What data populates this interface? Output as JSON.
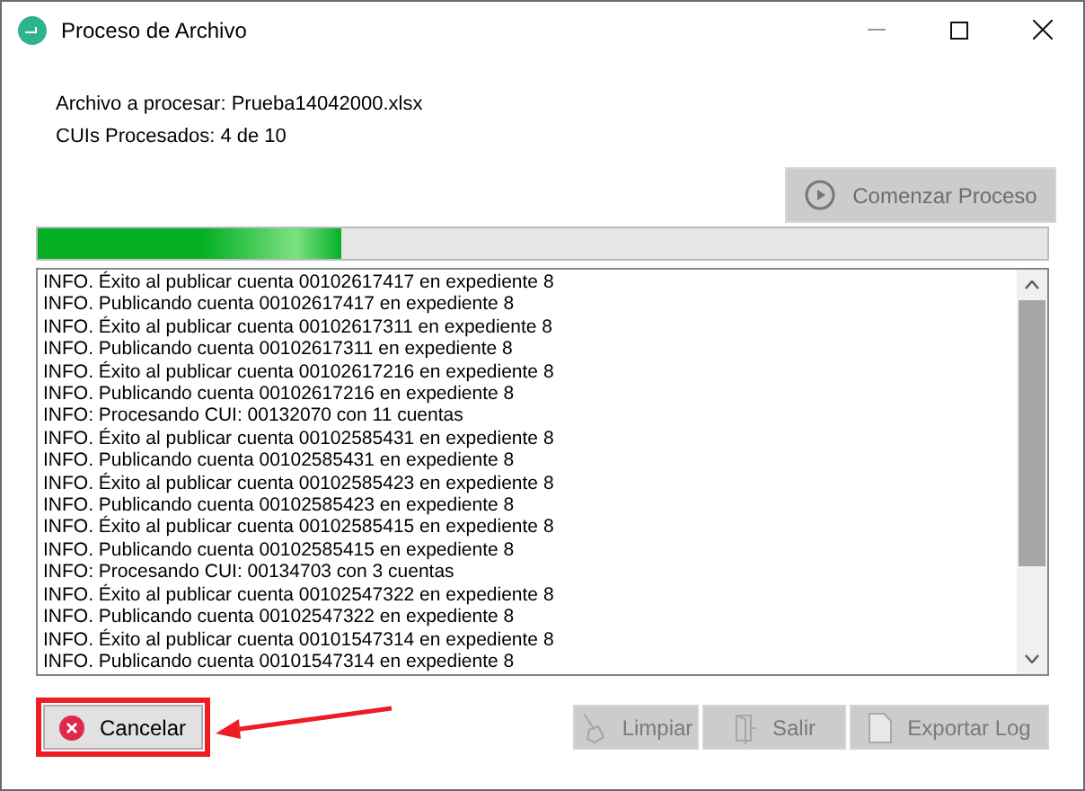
{
  "window": {
    "title": "Proceso de Archivo"
  },
  "info": [
    "Archivo a procesar: Prueba14042000.xlsx",
    "CUIs Procesados: 4 de 10"
  ],
  "start_button": {
    "label": "Comenzar Proceso",
    "disabled": true
  },
  "progress": {
    "level": 0.3
  },
  "log": [
    "INFO. Éxito al publicar cuenta 00102617417 en expediente 8",
    "INFO. Publicando cuenta 00102617417 en expediente 8",
    "INFO. Éxito al publicar cuenta 00102617311 en expediente 8",
    "INFO. Publicando cuenta 00102617311 en expediente 8",
    "INFO. Éxito al publicar cuenta 00102617216 en expediente 8",
    "INFO. Publicando cuenta 00102617216 en expediente 8",
    "INFO: Procesando CUI: 00132070 con 11 cuentas",
    "INFO. Éxito al publicar cuenta 00102585431 en expediente 8",
    "INFO. Publicando cuenta 00102585431 en expediente 8",
    "INFO. Éxito al publicar cuenta 00102585423 en expediente 8",
    "INFO. Publicando cuenta 00102585423 en expediente 8",
    "INFO. Éxito al publicar cuenta 00102585415 en expediente 8",
    "INFO. Publicando cuenta 00102585415 en expediente 8",
    "INFO: Procesando CUI: 00134703 con 3 cuentas",
    "INFO. Éxito al publicar cuenta 00102547322 en expediente 8",
    "INFO. Publicando cuenta 00102547322 en expediente 8",
    "INFO. Éxito al publicar cuenta 00101547314 en expediente 8",
    "INFO. Publicando cuenta 00101547314 en expediente 8"
  ],
  "buttons": [
    {
      "kind": "cancel",
      "label": "Cancelar",
      "disabled": false,
      "highlighted": true
    },
    {
      "kind": "clear",
      "label": "Limpiar",
      "disabled": true,
      "highlighted": false
    },
    {
      "kind": "exit",
      "label": "Salir",
      "disabled": true,
      "highlighted": false
    },
    {
      "kind": "export",
      "label": "Exportar Log",
      "disabled": true,
      "highlighted": false
    }
  ]
}
